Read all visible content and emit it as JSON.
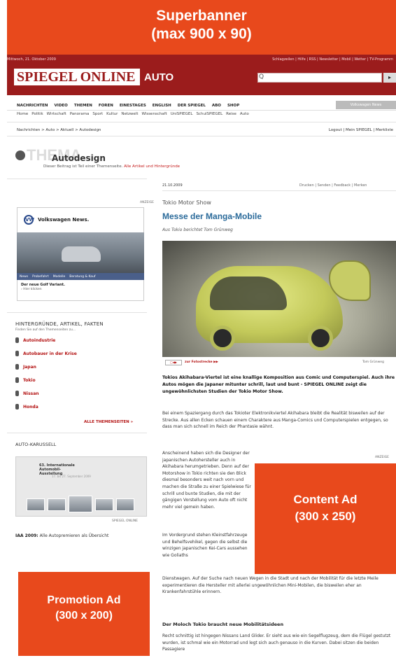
{
  "superbanner": {
    "line1": "Superbanner",
    "line2": "(max 900 x 90)"
  },
  "header": {
    "date": "Mittwoch, 21. Oktober 2009",
    "toplinks": "Schlagzeilen | Hilfe | RSS | Newsletter | Mobil | Wetter | TV-Programm",
    "logo": "SPIEGEL ONLINE",
    "section": "AUTO",
    "search_placeholder": "Q",
    "search_button": "▸"
  },
  "nav": {
    "items": [
      "NACHRICHTEN",
      "VIDEO",
      "THEMEN",
      "FOREN",
      "EINESTAGES",
      "ENGLISH",
      "DER SPIEGEL",
      "ABO",
      "SHOP"
    ],
    "vw_label": "Volkswagen News"
  },
  "subnav": [
    "Home",
    "Politik",
    "Wirtschaft",
    "Panorama",
    "Sport",
    "Kultur",
    "Netzwelt",
    "Wissenschaft",
    "UniSPIEGEL",
    "SchulSPIEGEL",
    "Reise",
    "Auto"
  ],
  "breadcrumb": "Nachrichten > Auto > Aktuell > Autodesign",
  "rightlinks": "Logout | Mein SPIEGEL | Merkliste",
  "thema": {
    "label": "THEMA",
    "title": "Autodesign",
    "desc": "Dieser Beitrag ist Teil einer Themenseite.",
    "desc_link": "Alle Artikel und Hintergründe"
  },
  "left": {
    "anzeige": "ANZEIGE",
    "vw_title": "Volkswagen News.",
    "vw_logo": "VW",
    "vw_tabs": [
      "News",
      "Probefahrt",
      "Modelle",
      "Beratung & Kauf"
    ],
    "vw_line1": "Der neue Golf Variant.",
    "vw_line2": "› Hier klicken",
    "hint_title": "HINTERGRÜNDE, ARTIKEL, FAKTEN",
    "hint_sub": "Finden Sie auf den Themenseiten zu...",
    "topics": [
      "Autoindustrie",
      "Autobauer in der Krise",
      "Japan",
      "Tokio",
      "Nissan",
      "Honda"
    ],
    "all_topics": "ALLE THEMENSEITEN »",
    "karussell_title": "AUTO-KARUSSELL",
    "karussell_head": "63. Internationale Automobil-Ausstellung",
    "karussell_date": "17. bis 27. September 2009",
    "karussell_credit": "SPIEGEL ONLINE",
    "iaa_bold": "IAA 2009:",
    "iaa_text": "Alle Autopremieren als Übersicht",
    "promo_line1": "Promotion Ad",
    "promo_line2": "(300 x 200)"
  },
  "article": {
    "date": "21.10.2009",
    "actions": "Drucken | Senden | Feedback | Merken",
    "kicker": "Tokio Motor Show",
    "title": "Messe der Manga-Mobile",
    "author": "Aus Tokio berichtet Tom Grünweg",
    "gallery_link": "zur Fotostrecke ▶▶",
    "photo_credit": "Tom Grünweg",
    "lead": "Tokios Akihabara-Viertel ist eine knallige Komposition aus Comic und Computerspiel. Auch ihre Autos mögen die Japaner mitunter schrill, laut und bunt - SPIEGEL ONLINE zeigt die ungewöhnlichsten Studien der Tokio Motor Show.",
    "p1": "Bei einem Spaziergang durch das Tokioter Elektronikviertel Akihabara bleibt die Realität bisweilen auf der Strecke. Aus allen Ecken schauen einem Charaktere aus Manga-Comics und Computerspielen entgegen, so dass man sich schnell im Reich der Phantasie wähnt.",
    "p2": "Anscheinend haben sich die Designer der japanischen Autohersteller auch in Akihabara herumgetrieben. Denn auf der Motorshow in Tokio richten sie den Blick diesmal besonders weit nach vorn und machen die Straße zu einer Spielwiese für schrill und bunte Studien, die mit der gängigen Vorstellung vom Auto oft nicht mehr viel gemein haben.",
    "p3": "Im Vordergrund stehen Kleinstfahrzeuge und Behelfsvehikel, gegen die selbst die winzigen japanischen Kei-Cars aussehen wie Goliaths",
    "p4": "Dienstwagen. Auf der Suche nach neuen Wegen in die Stadt und nach der Mobilität für die letzte Meile experimentieren die Hersteller mit allerlei ungewöhnlichen Mini-Mobilen, die bisweilen eher an Krankenfahrstühle erinnern.",
    "subhead": "Der Moloch Tokio braucht neue Mobilitätsideen",
    "p5": "Recht schnittig ist hingegen Nissans Land Glider. Er sieht aus wie ein Segelflugzeug, dem die Flügel gestutzt wurden, ist schmal wie ein Motorrad und legt sich auch genauso in die Kurven. Dabei sitzen die beiden Passagiere",
    "anzeige": "ANZEIGE",
    "content_ad_line1": "Content Ad",
    "content_ad_line2": "(300 x 250)"
  },
  "colors": {
    "ad_orange": "#e8491c",
    "brand_red": "#9b1c1c",
    "link_red": "#b31212",
    "title_blue": "#2a6a9a"
  }
}
